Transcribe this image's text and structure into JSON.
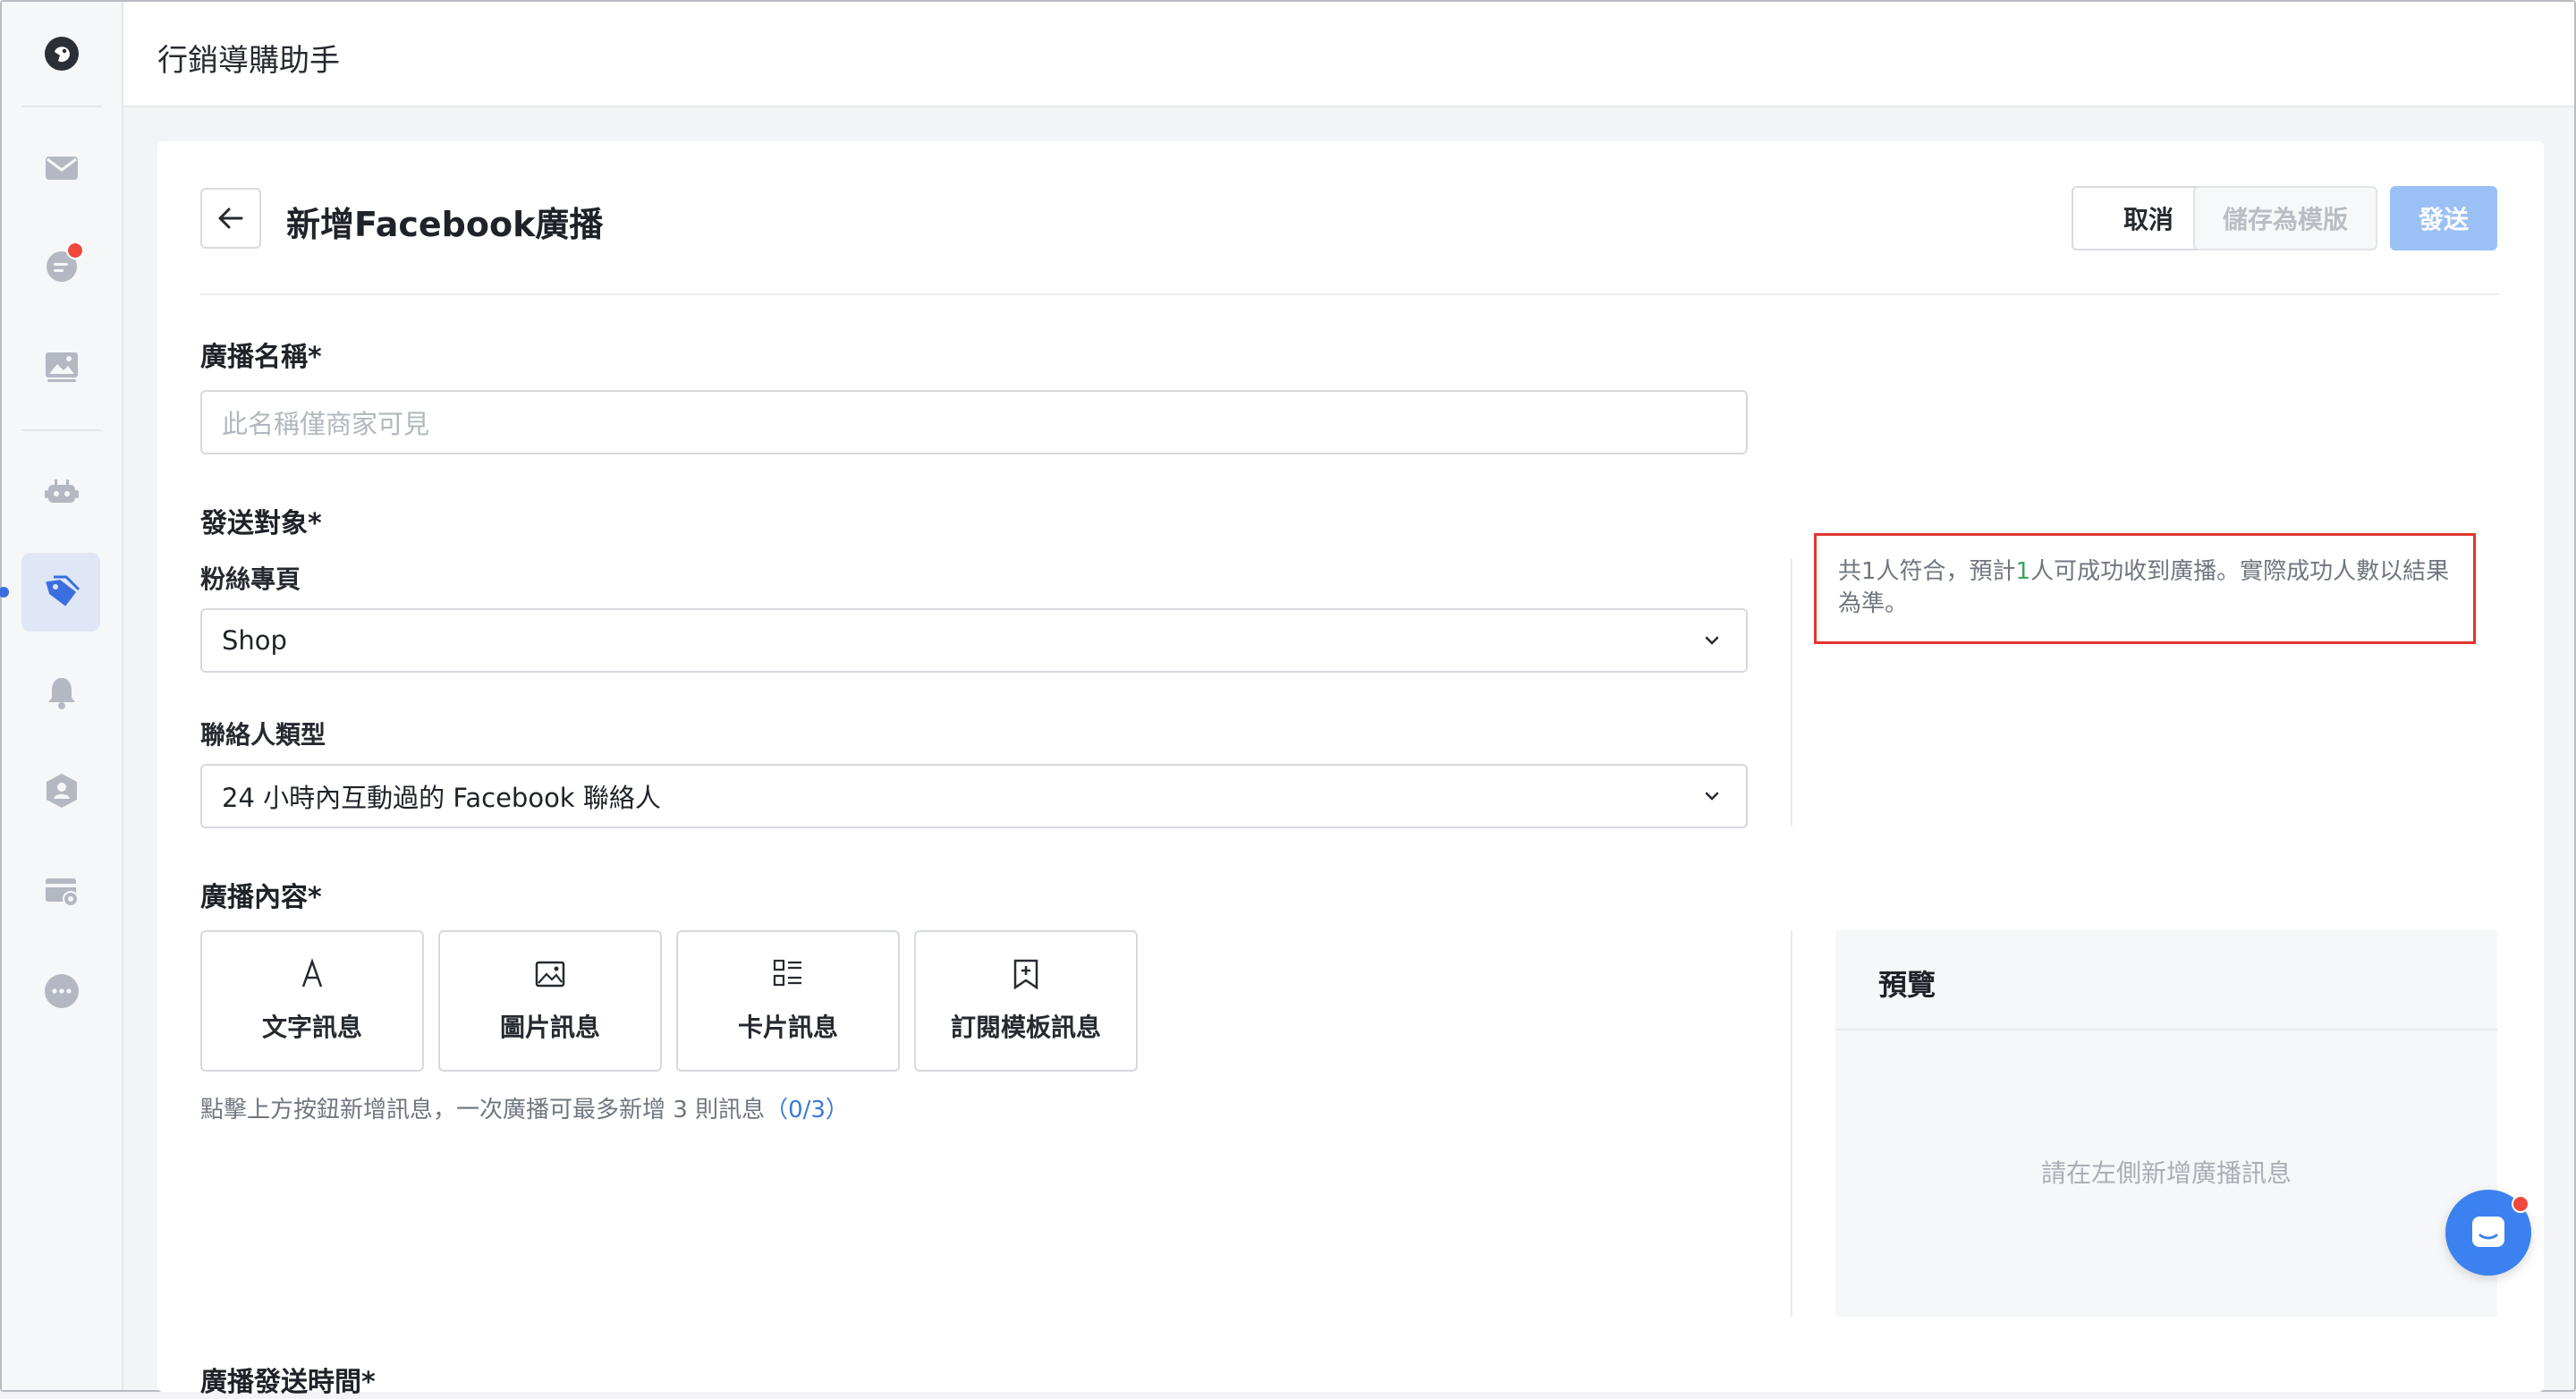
{
  "app": {
    "title": "行銷導購助手"
  },
  "sidebar": {
    "items": [
      {
        "icon": "inbox-icon"
      },
      {
        "icon": "chat-bubble-icon",
        "has_notification": true
      },
      {
        "icon": "image-gallery-icon"
      },
      {
        "icon": "robot-icon"
      },
      {
        "icon": "tag-icon",
        "active": true
      },
      {
        "icon": "bell-icon"
      },
      {
        "icon": "contact-shield-icon"
      },
      {
        "icon": "card-settings-icon"
      },
      {
        "icon": "more-icon"
      }
    ]
  },
  "header": {
    "title": "新增Facebook廣播",
    "cancel_label": "取消",
    "save_template_label": "儲存為模版",
    "send_label": "發送"
  },
  "form": {
    "name_label": "廣播名稱*",
    "name_placeholder": "此名稱僅商家可見",
    "audience_label": "發送對象*",
    "fanpage_label": "粉絲專頁",
    "fanpage_value": "Shop",
    "contact_type_label": "聯絡人類型",
    "contact_type_value": "24 小時內互動過的 Facebook 聯絡人",
    "content_label": "廣播內容*",
    "message_types": [
      {
        "icon": "text-icon",
        "label": "文字訊息"
      },
      {
        "icon": "image-icon",
        "label": "圖片訊息"
      },
      {
        "icon": "card-list-icon",
        "label": "卡片訊息"
      },
      {
        "icon": "bookmark-plus-icon",
        "label": "訂閱模板訊息"
      }
    ],
    "hint_text": "點擊上方按鈕新增訊息，一次廣播可最多新增 3 則訊息",
    "hint_count": "（0/3）",
    "send_time_label": "廣播發送時間*"
  },
  "audience_note": {
    "prefix": "共1人符合，預計",
    "count": "1",
    "suffix": "人可成功收到廣播。實際成功人數以結果為準。"
  },
  "preview": {
    "title": "預覽",
    "empty_text": "請在左側新增廣播訊息"
  },
  "colors": {
    "accent": "#3b82f0",
    "send_disabled": "#9ac0f6",
    "highlight_border": "#e0362f",
    "count_green": "#3aa35f"
  }
}
